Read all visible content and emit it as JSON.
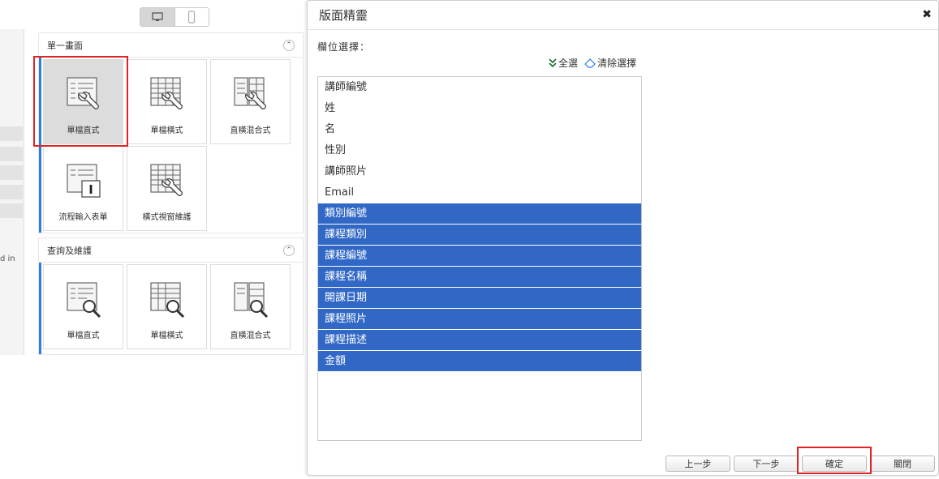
{
  "background": {
    "panel1": {
      "title": "單一畫面",
      "collapse": "⌃",
      "tiles": [
        "單檔直式",
        "單檔橫式",
        "直橫混合式",
        "流程輸入表單",
        "橫式視窗維護"
      ]
    },
    "panel2": {
      "title": "查詢及維護",
      "collapse": "⌃",
      "tiles": [
        "單檔直式",
        "單檔橫式",
        "直橫混合式"
      ]
    },
    "strip_text": "d in"
  },
  "dialog": {
    "title": "版面精靈",
    "close": "✖",
    "field_label": "欄位選擇：",
    "select_all": "全選",
    "clear_selection": "清除選擇",
    "fields": [
      {
        "label": "講師編號",
        "selected": false
      },
      {
        "label": "姓",
        "selected": false
      },
      {
        "label": "名",
        "selected": false
      },
      {
        "label": "性別",
        "selected": false
      },
      {
        "label": "講師照片",
        "selected": false
      },
      {
        "label": "Email",
        "selected": false
      },
      {
        "label": "類別編號",
        "selected": true
      },
      {
        "label": "課程類別",
        "selected": true
      },
      {
        "label": "課程編號",
        "selected": true
      },
      {
        "label": "課程名稱",
        "selected": true
      },
      {
        "label": "開課日期",
        "selected": true
      },
      {
        "label": "課程照片",
        "selected": true
      },
      {
        "label": "課程描述",
        "selected": true
      },
      {
        "label": "金額",
        "selected": true
      }
    ],
    "buttons": {
      "prev": "上一步",
      "next": "下一步",
      "confirm": "確定",
      "close": "關閉"
    }
  },
  "colors": {
    "selection": "#3168c6",
    "highlight_outline": "#e02424",
    "panel_accent": "#2a7de1"
  }
}
